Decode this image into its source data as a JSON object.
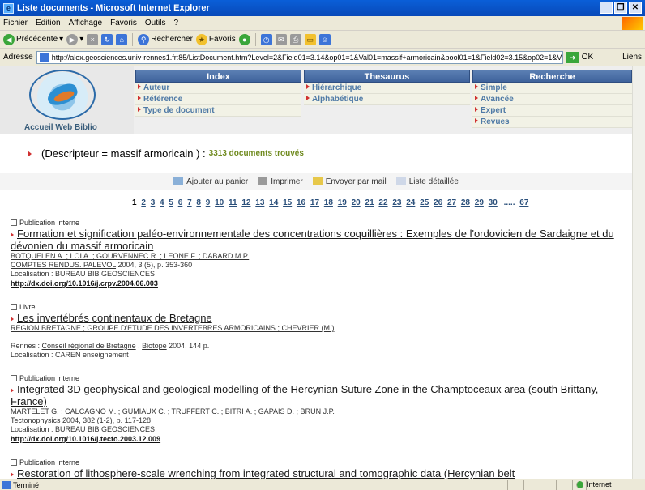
{
  "window": {
    "title": "Liste documents - Microsoft Internet Explorer",
    "buttons": [
      "_",
      "❒",
      "✕"
    ]
  },
  "menu": [
    "Fichier",
    "Edition",
    "Affichage",
    "Favoris",
    "Outils",
    "?"
  ],
  "toolbar": {
    "back": "Précédente",
    "search": "Rechercher",
    "favorites": "Favoris"
  },
  "address": {
    "label": "Adresse",
    "url": "http://alex.geosciences.univ-rennes1.fr:85/ListDocument.htm?Level=2&Field01=3.14&op01=1&Val01=massif+armoricain&bool01=1&Field02=3.15&op02=1&Val02=&bool0",
    "go": "OK",
    "links": "Liens"
  },
  "header": {
    "logo_label": "Accueil Web Biblio",
    "index": {
      "title": "Index",
      "items": [
        "Auteur",
        "Référence",
        "Type de document"
      ]
    },
    "thesaurus": {
      "title": "Thesaurus",
      "items": [
        "Hiérarchique",
        "Alphabétique"
      ]
    },
    "recherche": {
      "title": "Recherche",
      "items": [
        "Simple",
        "Avancée",
        "Expert",
        "Revues"
      ]
    }
  },
  "query": {
    "text": "(Descripteur = massif armoricain ) :",
    "count": "3313 documents trouvés"
  },
  "actions": {
    "cart": "Ajouter au panier",
    "print": "Imprimer",
    "mail": "Envoyer par mail",
    "detail": "Liste détaillée"
  },
  "pagination": {
    "pages": [
      "1",
      "2",
      "3",
      "4",
      "5",
      "6",
      "7",
      "8",
      "9",
      "10",
      "11",
      "12",
      "13",
      "14",
      "15",
      "16",
      "17",
      "18",
      "19",
      "20",
      "21",
      "22",
      "23",
      "24",
      "25",
      "26",
      "27",
      "28",
      "29",
      "30"
    ],
    "dots": ".....",
    "last": "67"
  },
  "records": [
    {
      "type": "Publication interne",
      "title": "Formation et signification paléo-environnementale des concentrations coquillières : Exemples de l'ordovicien de Sardaigne et du dévonien du massif armoricain",
      "authors": "BOTQUELEN A. ; LOI A. ; GOURVENNEC R. ; LEONE F. ; DABARD M.P.",
      "journal": "COMPTES RENDUS. PALEVOL",
      "journal_tail": " 2004, 3 (5), p. 353-360",
      "localisation": "Localisation : BUREAU BIB GEOSCIENCES",
      "doi": "http://dx.doi.org/10.1016/j.crpv.2004.06.003"
    },
    {
      "type": "Livre",
      "title": "Les invertébrés continentaux de Bretagne",
      "authors": "REGION BRETAGNE ; GROUPE D'ETUDE DES INVERTEBRES ARMORICAINS ; CHEVRIER (M.)",
      "publisher_prefix": "Rennes : ",
      "publisher1": "Conseil régional de Bretagne",
      "publisher_sep": " , ",
      "publisher2": "Biotope",
      "publisher_tail": " 2004, 144 p.",
      "localisation": "Localisation : CAREN enseignement"
    },
    {
      "type": "Publication interne",
      "title": "Integrated 3D geophysical and geological modelling of the Hercynian Suture Zone in the Champtoceaux area (south Brittany, France)",
      "authors": "MARTELET G. ; CALCAGNO M. ; GUMIAUX C. ; TRUFFERT C. ; BITRI A. ; GAPAIS D. ; BRUN J.P.",
      "journal": "Tectonophysics",
      "journal_tail": " 2004, 382 (1-2), p. 117-128",
      "localisation": "Localisation : BUREAU BIB GEOSCIENCES",
      "doi": "http://dx.doi.org/10.1016/j.tecto.2003.12.009"
    },
    {
      "type": "Publication interne",
      "title": "Restoration of lithosphere-scale wrenching from integrated structural and tomographic data (Hercynian belt"
    }
  ],
  "status": {
    "text": "Terminé",
    "zone": "Internet"
  }
}
